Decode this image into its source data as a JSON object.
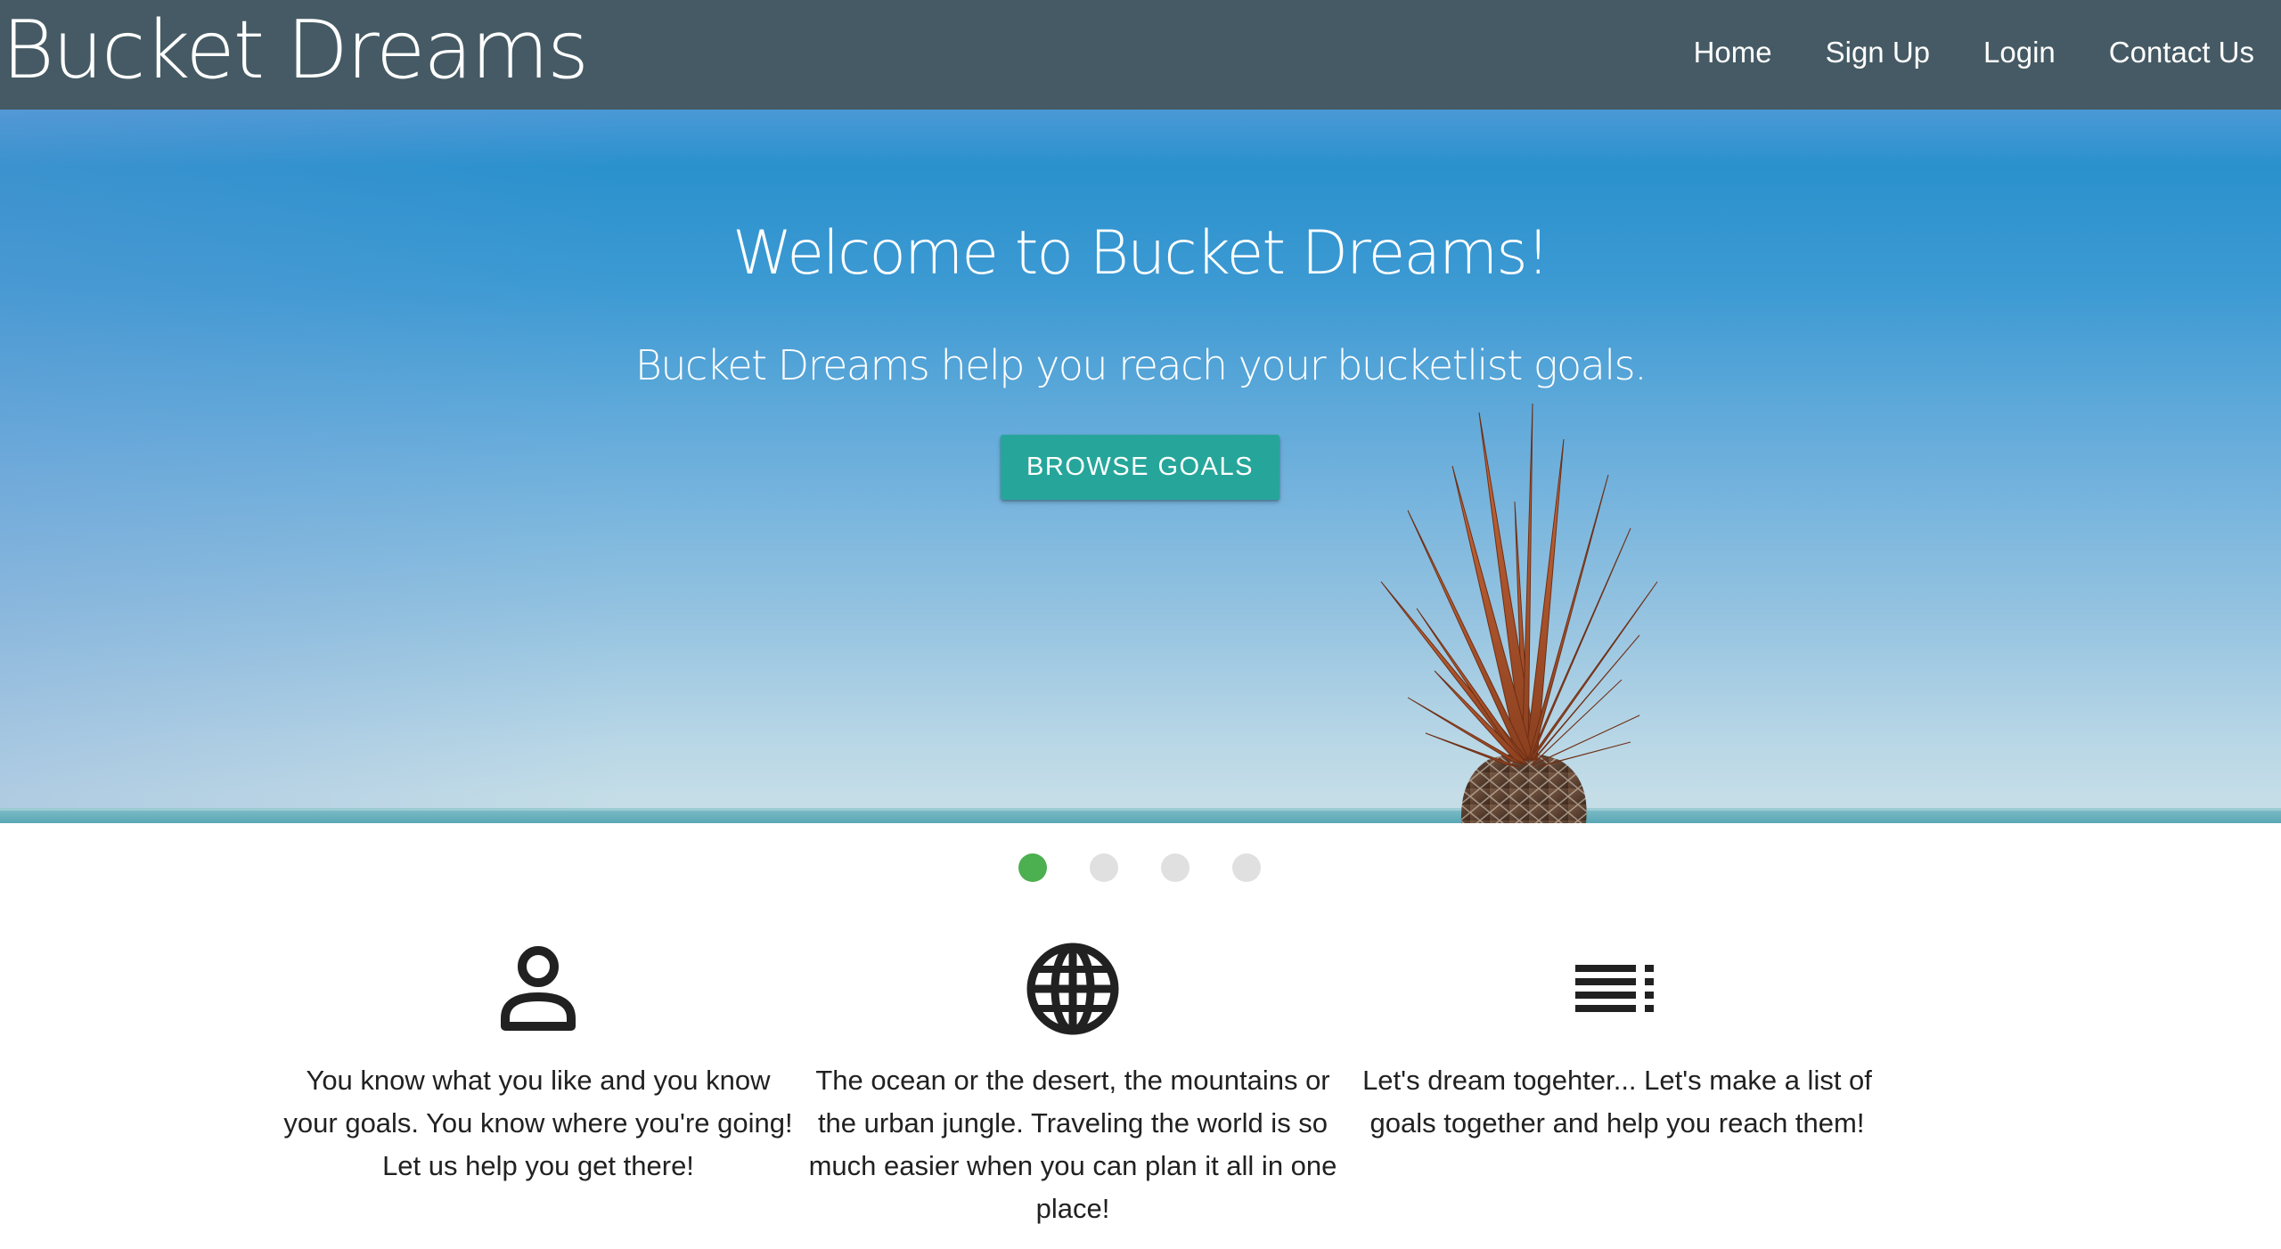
{
  "navbar": {
    "brand": "Bucket Dreams",
    "links": [
      "Home",
      "Sign Up",
      "Login",
      "Contact Us"
    ]
  },
  "hero": {
    "title": "Welcome to Bucket Dreams!",
    "subtitle": "Bucket Dreams help you reach your bucketlist goals.",
    "button_label": "BROWSE GOALS"
  },
  "carousel": {
    "slide_count": 4,
    "active_index": 0
  },
  "features": [
    {
      "icon": "person-icon",
      "text": "You know what you like and you know your goals. You know where you're going! Let us help you get there!"
    },
    {
      "icon": "globe-icon",
      "text": "The ocean or the desert, the mountains or the urban jungle. Traveling the world is so much easier when you can plan it all in one place!"
    },
    {
      "icon": "list-icon",
      "text": "Let's dream togehter... Let's make a list of goals together and help you reach them!"
    }
  ],
  "colors": {
    "navbar": "#455a64",
    "button": "#26a69a",
    "active_dot": "#4caf50",
    "inactive_dot": "#e0e0e0"
  }
}
